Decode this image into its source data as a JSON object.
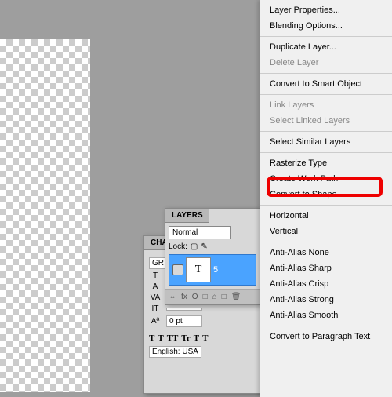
{
  "menu": {
    "items": [
      {
        "label": "Layer Properties...",
        "enabled": true,
        "sep": false
      },
      {
        "label": "Blending Options...",
        "enabled": true,
        "sep": false
      },
      {
        "label": "",
        "enabled": true,
        "sep": true
      },
      {
        "label": "Duplicate Layer...",
        "enabled": true,
        "sep": false
      },
      {
        "label": "Delete Layer",
        "enabled": false,
        "sep": false
      },
      {
        "label": "",
        "enabled": true,
        "sep": true
      },
      {
        "label": "Convert to Smart Object",
        "enabled": true,
        "sep": false
      },
      {
        "label": "",
        "enabled": true,
        "sep": true
      },
      {
        "label": "Link Layers",
        "enabled": false,
        "sep": false
      },
      {
        "label": "Select Linked Layers",
        "enabled": false,
        "sep": false
      },
      {
        "label": "",
        "enabled": true,
        "sep": true
      },
      {
        "label": "Select Similar Layers",
        "enabled": true,
        "sep": false
      },
      {
        "label": "",
        "enabled": true,
        "sep": true
      },
      {
        "label": "Rasterize Type",
        "enabled": true,
        "sep": false
      },
      {
        "label": "Create Work Path",
        "enabled": true,
        "sep": false
      },
      {
        "label": "Convert to Shape",
        "enabled": true,
        "sep": false
      },
      {
        "label": "",
        "enabled": true,
        "sep": true
      },
      {
        "label": "Horizontal",
        "enabled": true,
        "sep": false
      },
      {
        "label": "Vertical",
        "enabled": true,
        "sep": false
      },
      {
        "label": "",
        "enabled": true,
        "sep": true
      },
      {
        "label": "Anti-Alias None",
        "enabled": true,
        "sep": false
      },
      {
        "label": "Anti-Alias Sharp",
        "enabled": true,
        "sep": false
      },
      {
        "label": "Anti-Alias Crisp",
        "enabled": true,
        "sep": false
      },
      {
        "label": "Anti-Alias Strong",
        "enabled": true,
        "sep": false
      },
      {
        "label": "Anti-Alias Smooth",
        "enabled": true,
        "sep": false
      },
      {
        "label": "",
        "enabled": true,
        "sep": true
      },
      {
        "label": "Convert to Paragraph Text",
        "enabled": true,
        "sep": false
      }
    ]
  },
  "layers": {
    "tab": "LAYERS",
    "blend_mode": "Normal",
    "lock_label": "Lock:",
    "layer_name": "5",
    "thumb_letter": "T",
    "footer_icons": [
      "fx",
      "O",
      "□",
      "⌂",
      "□",
      "🗑"
    ]
  },
  "char": {
    "tab": "CHA",
    "font": "GR",
    "style": "",
    "size_icon": "T",
    "size": "",
    "leading_icon": "A",
    "leading": "",
    "kerning_icon": "VA",
    "kerning": "",
    "tracking_icon": "IT",
    "tracking": "",
    "vscale": "0 pt",
    "styles": [
      "T",
      "T",
      "TT",
      "Tr",
      "T",
      "T"
    ],
    "lang": "English: USA"
  }
}
